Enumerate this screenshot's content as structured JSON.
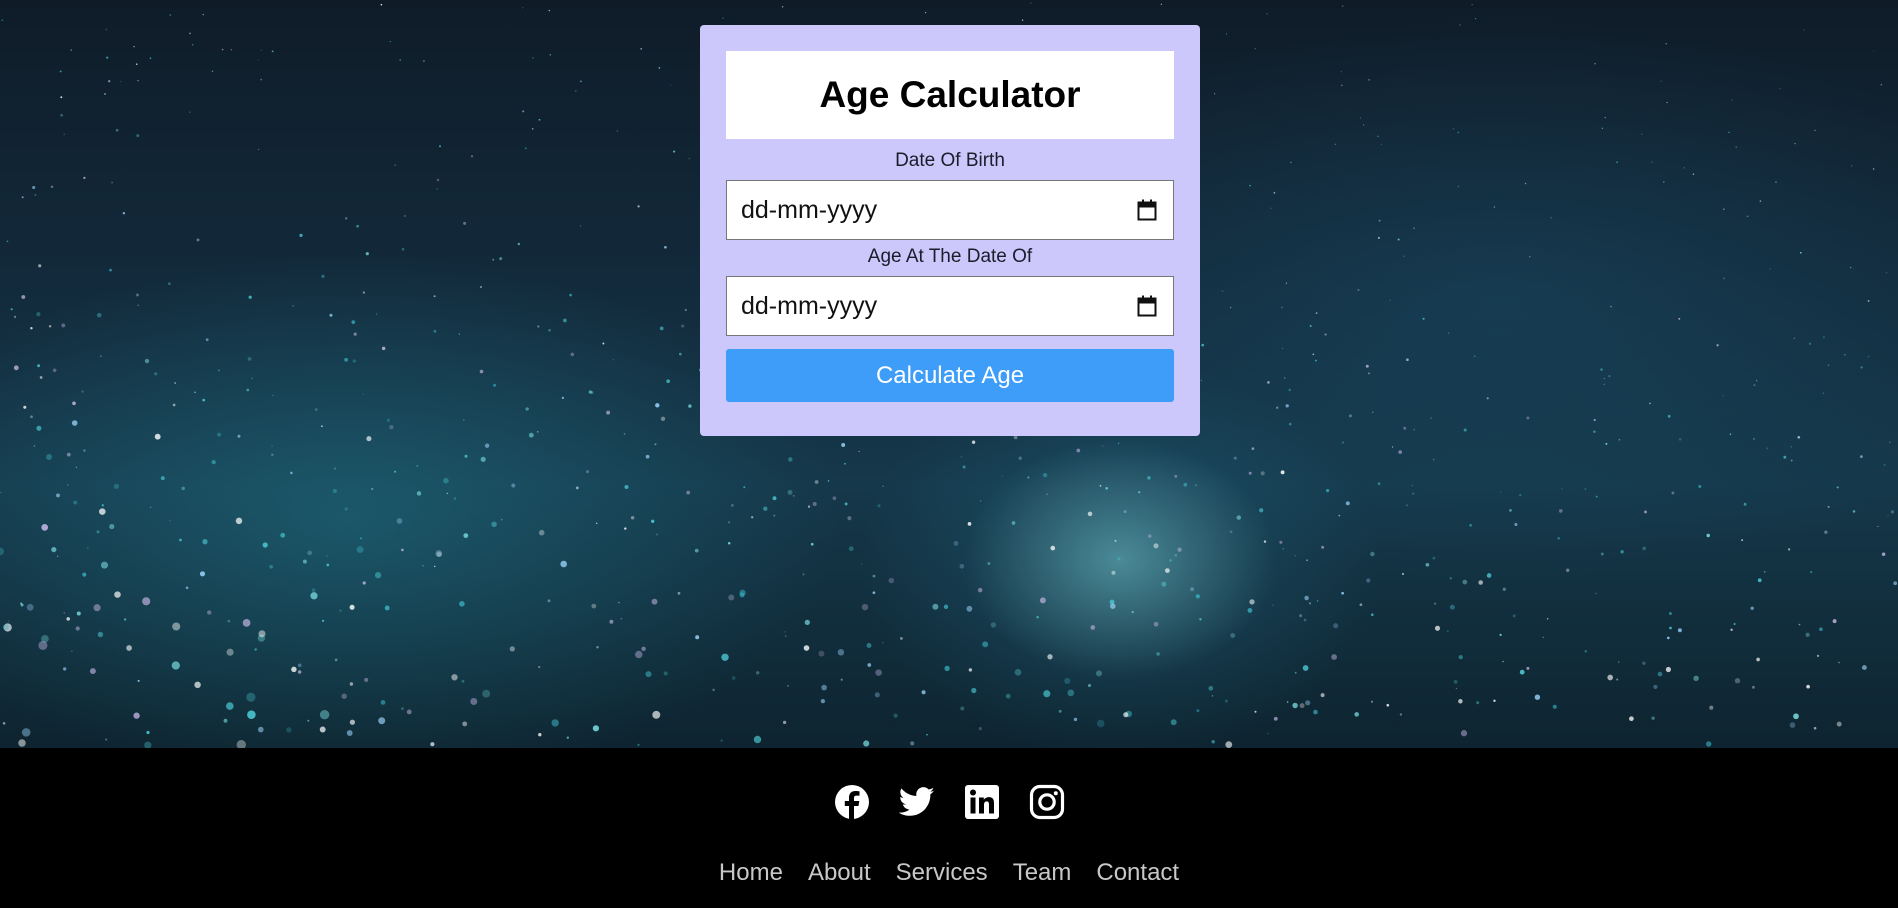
{
  "calculator": {
    "title": "Age Calculator",
    "dob_label": "Date Of Birth",
    "dob_placeholder": "dd-mm-yyyy",
    "target_label": "Age At The Date Of",
    "target_placeholder": "dd-mm-yyyy",
    "button_label": "Calculate Age"
  },
  "footer": {
    "social_icons": [
      "facebook-icon",
      "twitter-icon",
      "linkedin-icon",
      "instagram-icon"
    ],
    "nav": [
      "Home",
      "About",
      "Services",
      "Team",
      "Contact"
    ]
  },
  "colors": {
    "card_background": "#ccc8fc",
    "button": "#3d9df9",
    "footer_background": "#000000",
    "footer_link": "#c8c8c8"
  }
}
